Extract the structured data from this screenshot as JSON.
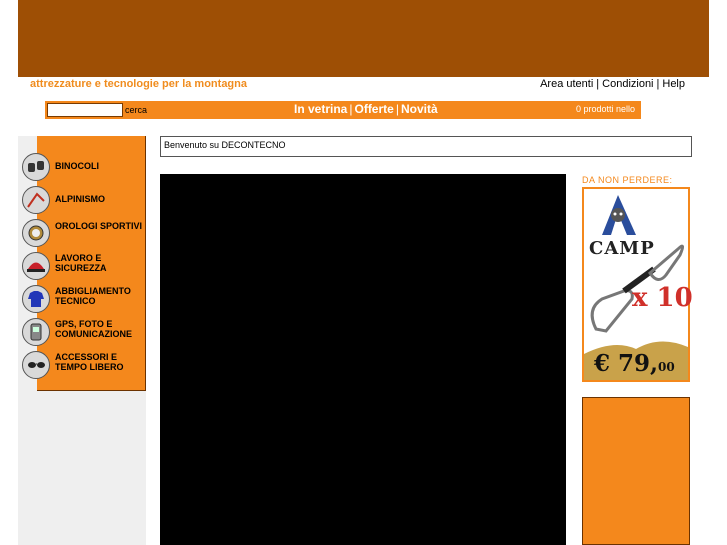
{
  "header": {
    "tagline": "attrezzature e tecnologie per la montagna",
    "links": [
      "Area utenti",
      "Condizioni",
      "Help"
    ]
  },
  "search": {
    "value": "",
    "label": "cerca"
  },
  "nav": {
    "items": [
      "In vetrina",
      "Offerte",
      "Novità"
    ]
  },
  "cart": {
    "status": "0 prodotti nello"
  },
  "categories": [
    {
      "label": "BINOCOLI",
      "icon": "binoculars-icon"
    },
    {
      "label": "ALPINISMO",
      "icon": "ice-axe-icon"
    },
    {
      "label": "OROLOGI SPORTIVI",
      "icon": "watch-icon"
    },
    {
      "label": "LAVORO E SICUREZZA",
      "icon": "helmet-icon"
    },
    {
      "label": "ABBIGLIAMENTO TECNICO",
      "icon": "jacket-icon"
    },
    {
      "label": "GPS, FOTO E COMUNICAZIONE",
      "icon": "gps-device-icon"
    },
    {
      "label": "ACCESSORI E TEMPO LIBERO",
      "icon": "sunglasses-icon"
    }
  ],
  "welcome": {
    "text": "Benvenuto su DECONTECNO"
  },
  "promo": {
    "title": "DA NON PERDERE:",
    "brand": "CAMP",
    "multiplier": "x 10",
    "price_main": "€ 79,",
    "price_cents": "00",
    "icon": "quickdraw-icon"
  },
  "colors": {
    "banner": "#9e4f05",
    "accent": "#f4881c",
    "panel_gray": "#efefef"
  }
}
